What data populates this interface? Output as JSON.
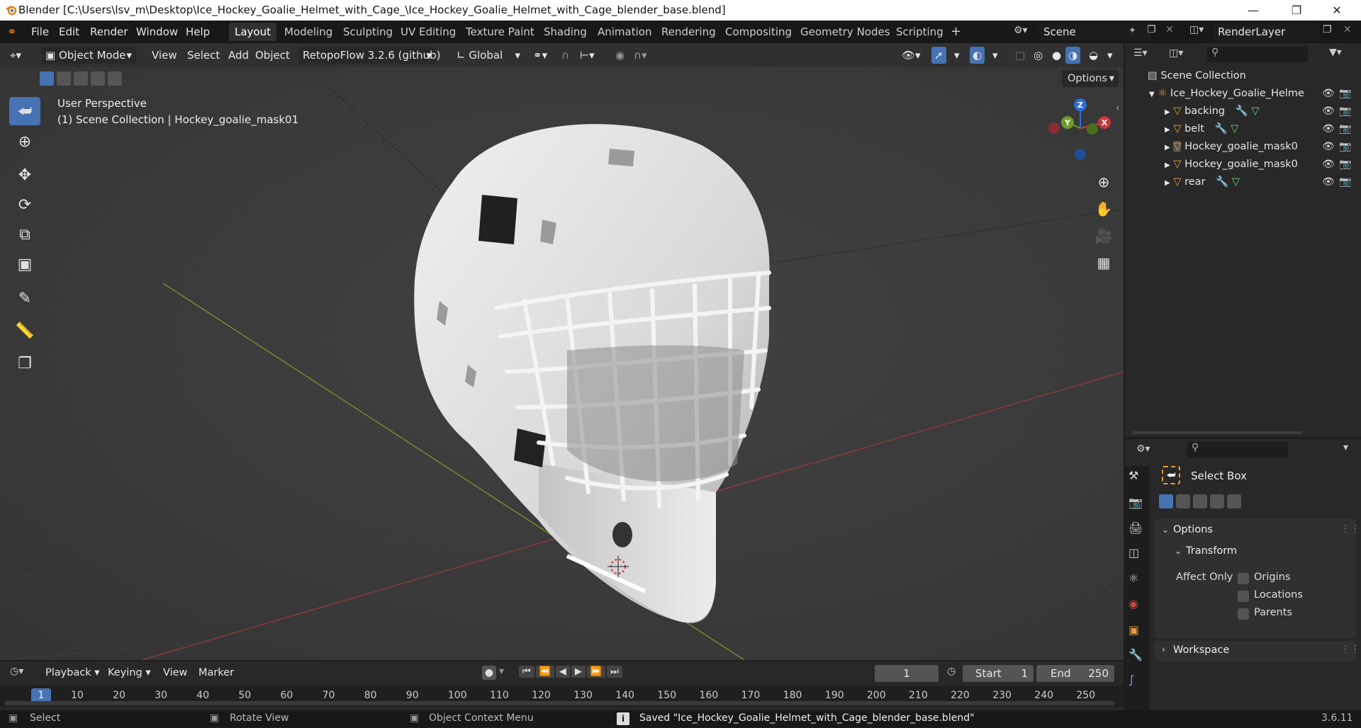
{
  "window": {
    "title": "Blender [C:\\Users\\lsv_m\\Desktop\\Ice_Hockey_Goalie_Helmet_with_Cage_\\Ice_Hockey_Goalie_Helmet_with_Cage_blender_base.blend]"
  },
  "menu": {
    "file": "File",
    "edit": "Edit",
    "render": "Render",
    "window": "Window",
    "help": "Help"
  },
  "workspaces": [
    "Layout",
    "Modeling",
    "Sculpting",
    "UV Editing",
    "Texture Paint",
    "Shading",
    "Animation",
    "Rendering",
    "Compositing",
    "Geometry Nodes",
    "Scripting"
  ],
  "active_workspace": "Layout",
  "scene": {
    "name": "Scene",
    "view_layer": "RenderLayer"
  },
  "viewport_header": {
    "mode": "Object Mode",
    "view": "View",
    "select": "Select",
    "add": "Add",
    "object": "Object",
    "addon": "RetopoFlow 3.2.6 (github)",
    "orientation": "Global",
    "options": "Options"
  },
  "viewport": {
    "perspective": "User Perspective",
    "collection_info": "(1) Scene Collection | Hockey_goalie_mask01",
    "gizmo": {
      "z": "Z",
      "y": "Y",
      "x": "X"
    }
  },
  "outliner": {
    "root": "Scene Collection",
    "collection": "Ice_Hockey_Goalie_Helme",
    "objects": [
      {
        "name": "backing"
      },
      {
        "name": "belt"
      },
      {
        "name": "Hockey_goalie_mask0"
      },
      {
        "name": "Hockey_goalie_mask0"
      },
      {
        "name": "rear"
      }
    ]
  },
  "properties": {
    "tool_name": "Select Box",
    "options_label": "Options",
    "transform_label": "Transform",
    "affect_only": "Affect Only",
    "origins": "Origins",
    "locations": "Locations",
    "parents": "Parents",
    "workspace_label": "Workspace"
  },
  "timeline": {
    "playback": "Playback",
    "keying": "Keying",
    "view": "View",
    "marker": "Marker",
    "current_frame": "1",
    "start_label": "Start",
    "start": "1",
    "end_label": "End",
    "end": "250",
    "ruler": [
      "10",
      "20",
      "30",
      "40",
      "50",
      "60",
      "70",
      "80",
      "90",
      "100",
      "110",
      "120",
      "130",
      "140",
      "150",
      "160",
      "170",
      "180",
      "190",
      "200",
      "210",
      "220",
      "230",
      "240",
      "250"
    ],
    "ruler_current": "1"
  },
  "status": {
    "select": "Select",
    "rotate": "Rotate View",
    "context": "Object Context Menu",
    "message": "Saved \"Ice_Hockey_Goalie_Helmet_with_Cage_blender_base.blend\"",
    "version": "3.6.11"
  },
  "colors": {
    "accent": "#4772b3",
    "orange": "#e89c3c",
    "axis_x": "#c8373f",
    "axis_y": "#6e9a2c",
    "axis_z": "#2c6ed6"
  }
}
